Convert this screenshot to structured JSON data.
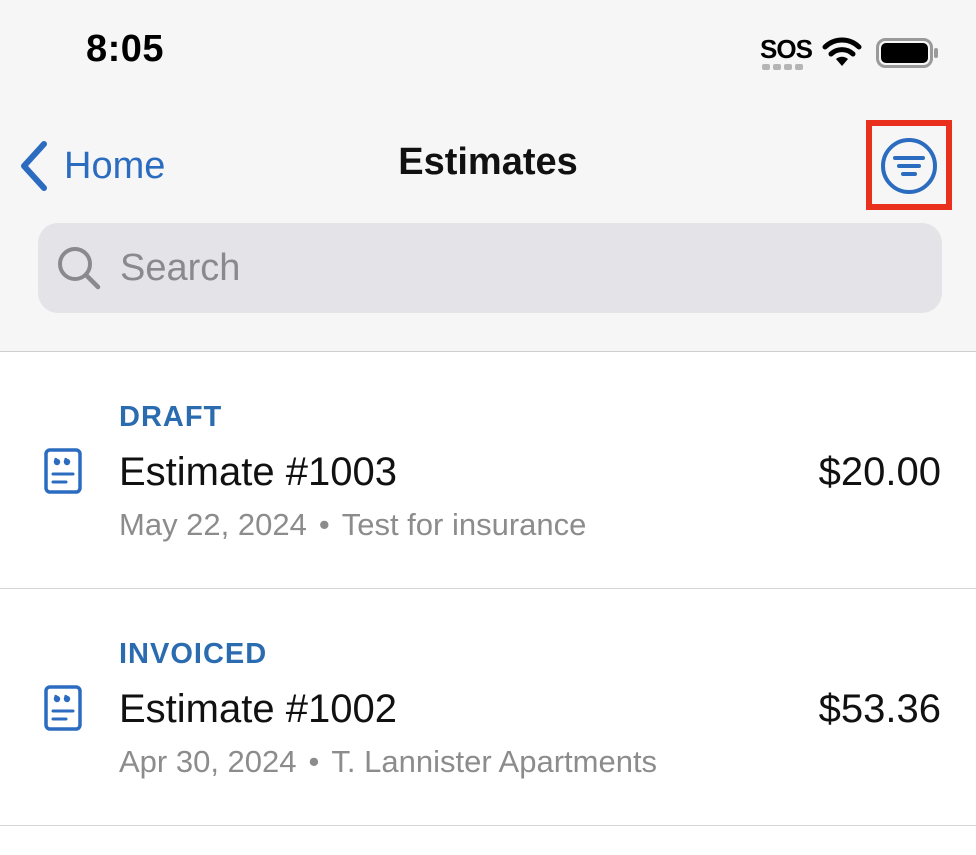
{
  "status_bar": {
    "time": "8:05",
    "sos_label": "SOS"
  },
  "nav": {
    "back_label": "Home",
    "title": "Estimates"
  },
  "search": {
    "placeholder": "Search",
    "value": ""
  },
  "colors": {
    "accent": "#2b6cc0",
    "highlight": "#e8301c",
    "secondary_text": "#8c8c8c"
  },
  "estimates": [
    {
      "status": "DRAFT",
      "title": "Estimate #1003",
      "amount": "$20.00",
      "date": "May 22, 2024",
      "separator": "•",
      "customer": "Test for insurance",
      "icon": "estimate-document-icon"
    },
    {
      "status": "INVOICED",
      "title": "Estimate #1002",
      "amount": "$53.36",
      "date": "Apr 30, 2024",
      "separator": "•",
      "customer": "T. Lannister Apartments",
      "icon": "estimate-document-icon"
    }
  ]
}
